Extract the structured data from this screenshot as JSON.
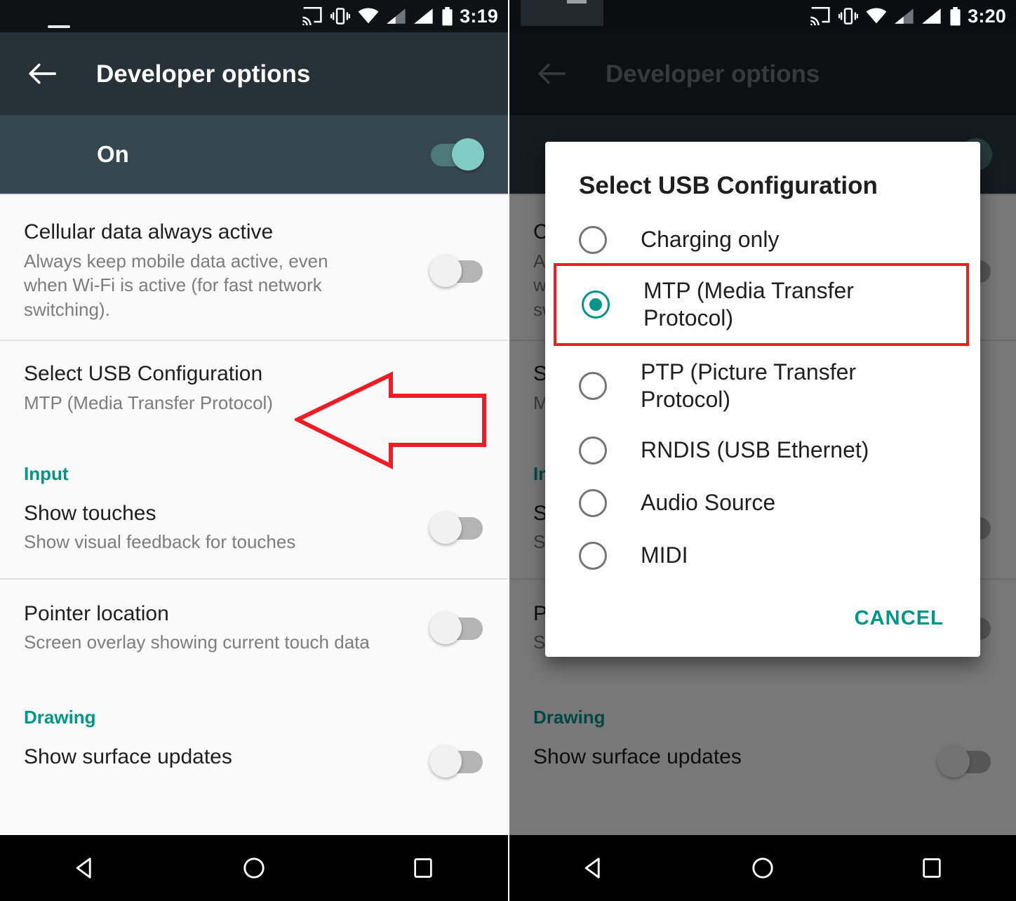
{
  "left_screen": {
    "status_bar": {
      "time": "3:19",
      "icons": [
        "cast-icon",
        "vibrate-icon",
        "wifi-icon",
        "signal-weak-icon",
        "signal-full-icon",
        "battery-icon"
      ]
    },
    "app_bar": {
      "back_icon": "back-arrow-icon",
      "title": "Developer options"
    },
    "master_switch": {
      "label": "On",
      "state": "on"
    },
    "settings": [
      {
        "title": "Cellular data always active",
        "subtitle": "Always keep mobile data active, even when Wi-Fi is active (for fast network switching).",
        "toggle": "off"
      },
      {
        "title": "Select USB Configuration",
        "subtitle": "MTP (Media Transfer Protocol)",
        "toggle": "none"
      }
    ],
    "sections": [
      {
        "header": "Input",
        "items": [
          {
            "title": "Show touches",
            "subtitle": "Show visual feedback for touches",
            "toggle": "off"
          },
          {
            "title": "Pointer location",
            "subtitle": "Screen overlay showing current touch data",
            "toggle": "off"
          }
        ]
      },
      {
        "header": "Drawing",
        "items": [
          {
            "title": "Show surface updates",
            "subtitle": "",
            "toggle": "off"
          }
        ]
      }
    ],
    "annotation": {
      "type": "left-pointing-arrow",
      "color": "#ee1c25",
      "points_at": "Select USB Configuration"
    },
    "nav_bar": {
      "back": "nav-back-icon",
      "home": "nav-home-icon",
      "recents": "nav-recents-icon"
    }
  },
  "right_screen": {
    "status_bar": {
      "time": "3:20",
      "icons": [
        "cast-icon",
        "vibrate-icon",
        "wifi-icon",
        "signal-weak-icon",
        "signal-full-icon",
        "battery-icon"
      ]
    },
    "app_bar": {
      "back_icon": "back-arrow-icon",
      "title": "Developer options"
    },
    "dialog": {
      "title": "Select USB Configuration",
      "options": [
        {
          "label": "Charging only",
          "selected": false,
          "highlighted": false
        },
        {
          "label": "MTP (Media Transfer Protocol)",
          "selected": true,
          "highlighted": true
        },
        {
          "label": "PTP (Picture Transfer Protocol)",
          "selected": false,
          "highlighted": false
        },
        {
          "label": "RNDIS (USB Ethernet)",
          "selected": false,
          "highlighted": false
        },
        {
          "label": "Audio Source",
          "selected": false,
          "highlighted": false
        },
        {
          "label": "MIDI",
          "selected": false,
          "highlighted": false
        }
      ],
      "cancel_label": "CANCEL"
    },
    "nav_bar": {
      "back": "nav-back-icon",
      "home": "nav-home-icon",
      "recents": "nav-recents-icon"
    }
  },
  "colors": {
    "accent_teal": "#009688",
    "annotation_red": "#ee1c25",
    "appbar_dark": "#263238",
    "master_row": "#37474f",
    "toggle_on_thumb": "#80cbc4"
  }
}
